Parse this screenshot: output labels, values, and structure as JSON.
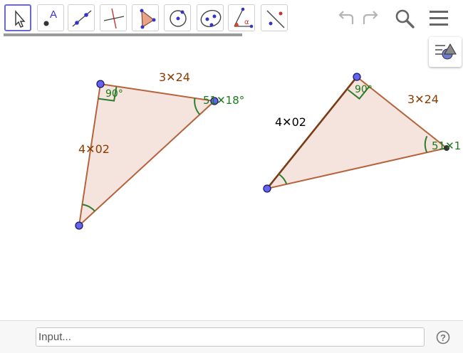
{
  "colors": {
    "selected_border": "#6a6acb",
    "triangle_fill": "#f5e4dd",
    "triangle_edge": "#b4643c",
    "angle_mark": "#2f7d2f",
    "point_fill": "#6464f0",
    "side_label": "#8b3a00",
    "angle_label": "#1a7a1a"
  },
  "toolbar": {
    "tools": [
      {
        "name": "move-tool-icon"
      },
      {
        "name": "point-tool-icon",
        "glyph": "A"
      },
      {
        "name": "line-tool-icon"
      },
      {
        "name": "perpendicular-line-tool-icon"
      },
      {
        "name": "polygon-tool-icon"
      },
      {
        "name": "circle-center-point-tool-icon"
      },
      {
        "name": "ellipse-tool-icon"
      },
      {
        "name": "angle-tool-icon",
        "glyph": "α"
      },
      {
        "name": "reflect-tool-icon"
      }
    ],
    "undo_icon": "undo-icon",
    "redo_icon": "redo-icon",
    "search_icon": "search-icon",
    "menu_icon": "menu-icon"
  },
  "style_bar": {
    "icon": "style-bar-toggle-icon"
  },
  "triangle1": {
    "side_top": "3✕24",
    "side_left": "4✕02",
    "angle_right": "90°",
    "angle_acute": "51✕18°"
  },
  "triangle2": {
    "side_left": "4✕02",
    "side_right": "3✕24",
    "angle_right": "90°",
    "angle_acute": "51✕1"
  },
  "input_bar": {
    "placeholder": "Input..."
  },
  "help": {
    "glyph": "?"
  }
}
